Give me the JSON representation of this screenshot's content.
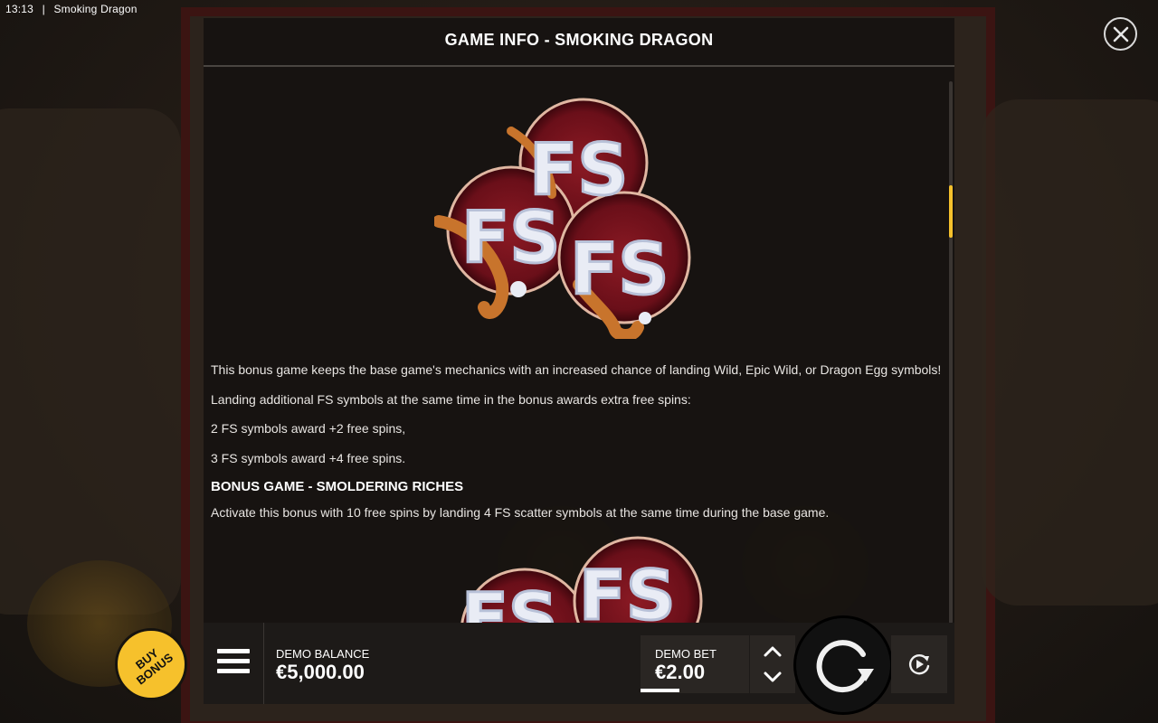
{
  "status_bar": {
    "time": "13:13",
    "separator": "|",
    "app_title": "Smoking Dragon"
  },
  "info_panel": {
    "title": "GAME INFO - SMOKING DRAGON",
    "close_icon": "close-icon",
    "section1": {
      "image_icon": "fs-scatter-symbols",
      "paragraphs": [
        "This bonus game keeps the base game's mechanics with an increased chance of landing Wild, Epic Wild, or Dragon Egg symbols!",
        "Landing additional FS symbols at the same time in the bonus awards extra free spins:",
        "2 FS symbols award +2 free spins,",
        "3 FS symbols award +4 free spins."
      ]
    },
    "section2": {
      "heading": "BONUS GAME - SMOLDERING RICHES",
      "paragraph": "Activate this bonus with 10 free spins by landing 4 FS scatter symbols at the same time during the base game.",
      "image_icon": "fs-scatter-symbols"
    },
    "image_text": "FS",
    "scroll_fraction": 0.19
  },
  "bottom_bar": {
    "buy_bonus": "BUY BONUS",
    "menu_icon": "hamburger-icon",
    "balance_label": "DEMO BALANCE",
    "balance_value": "€5,000.00",
    "bet_label": "DEMO BET",
    "bet_value": "€2.00",
    "spin_icon": "spin-icon",
    "autoplay_icon": "autoplay-icon"
  },
  "colors": {
    "accent": "#f6c12c",
    "panel": "#161210",
    "bar": "#1d1a18",
    "frame": "#3b1412"
  }
}
